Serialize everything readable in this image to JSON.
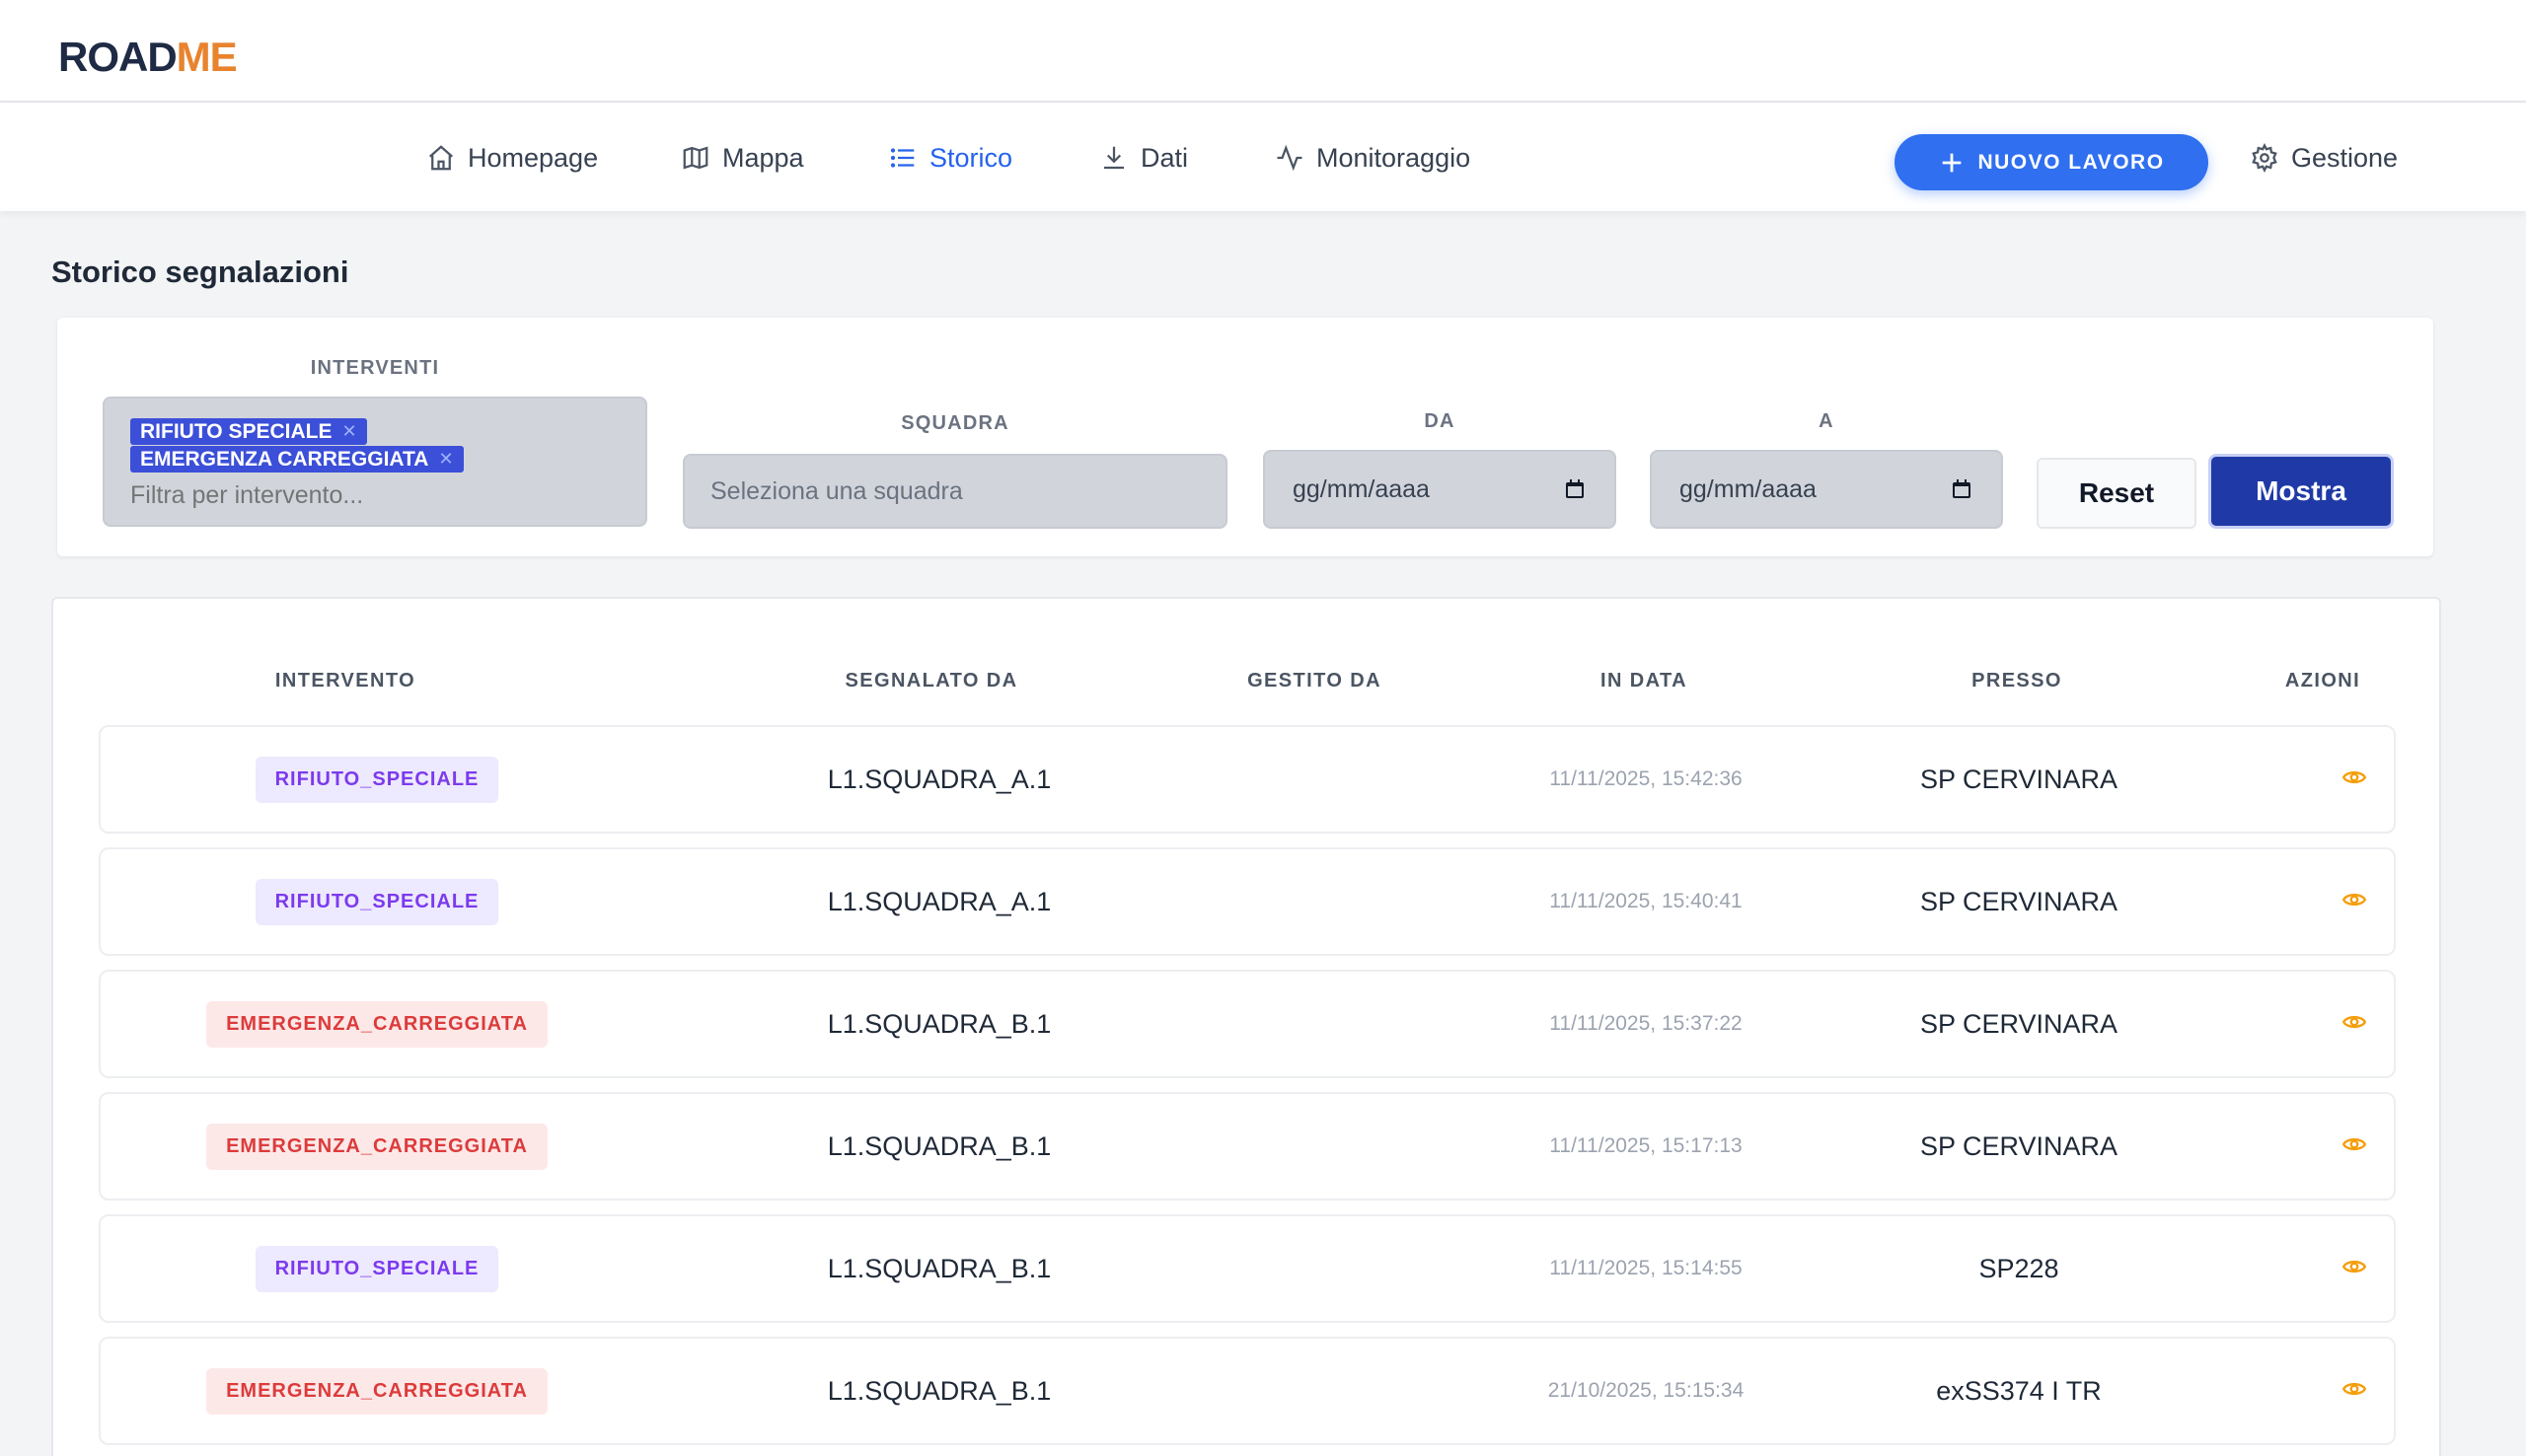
{
  "brand": {
    "part1": "ROAD",
    "part2": "ME"
  },
  "nav": {
    "homepage": "Homepage",
    "mappa": "Mappa",
    "storico": "Storico",
    "dati": "Dati",
    "monitoraggio": "Monitoraggio",
    "nuovo_lavoro": "NUOVO LAVORO",
    "gestione": "Gestione",
    "active": "Storico"
  },
  "page": {
    "title": "Storico segnalazioni"
  },
  "filters": {
    "interventi_label": "INTERVENTI",
    "chips": [
      "RIFIUTO SPECIALE",
      "EMERGENZA CARREGGIATA"
    ],
    "interventi_placeholder": "Filtra per intervento...",
    "squadra_label": "SQUADRA",
    "squadra_placeholder": "Seleziona una squadra",
    "da_label": "DA",
    "da_placeholder": "gg/mm/aaaa",
    "a_label": "A",
    "a_placeholder": "gg/mm/aaaa",
    "reset": "Reset",
    "mostra": "Mostra"
  },
  "table": {
    "headers": {
      "intervento": "INTERVENTO",
      "segnalato_da": "SEGNALATO DA",
      "gestito_da": "GESTITO DA",
      "in_data": "IN DATA",
      "presso": "PRESSO",
      "azioni": "AZIONI"
    },
    "rows": [
      {
        "intervento": "RIFIUTO_SPECIALE",
        "segnalato_da": "L1.SQUADRA_A.1",
        "gestito_da": "",
        "in_data": "11/11/2025, 15:42:36",
        "presso": "SP CERVINARA"
      },
      {
        "intervento": "RIFIUTO_SPECIALE",
        "segnalato_da": "L1.SQUADRA_A.1",
        "gestito_da": "",
        "in_data": "11/11/2025, 15:40:41",
        "presso": "SP CERVINARA"
      },
      {
        "intervento": "EMERGENZA_CARREGGIATA",
        "segnalato_da": "L1.SQUADRA_B.1",
        "gestito_da": "",
        "in_data": "11/11/2025, 15:37:22",
        "presso": "SP CERVINARA"
      },
      {
        "intervento": "EMERGENZA_CARREGGIATA",
        "segnalato_da": "L1.SQUADRA_B.1",
        "gestito_da": "",
        "in_data": "11/11/2025, 15:17:13",
        "presso": "SP CERVINARA"
      },
      {
        "intervento": "RIFIUTO_SPECIALE",
        "segnalato_da": "L1.SQUADRA_B.1",
        "gestito_da": "",
        "in_data": "11/11/2025, 15:14:55",
        "presso": "SP228"
      },
      {
        "intervento": "EMERGENZA_CARREGGIATA",
        "segnalato_da": "L1.SQUADRA_B.1",
        "gestito_da": "",
        "in_data": "21/10/2025, 15:15:34",
        "presso": "exSS374 I TR"
      }
    ],
    "row_action_icon": "eye-icon"
  },
  "colors": {
    "accent": "#2f6ff0",
    "primary_dark": "#1f3aa6",
    "badge_purple": "#7c3aed",
    "badge_red": "#dc3b3b",
    "logo_me": "#e8832e"
  }
}
